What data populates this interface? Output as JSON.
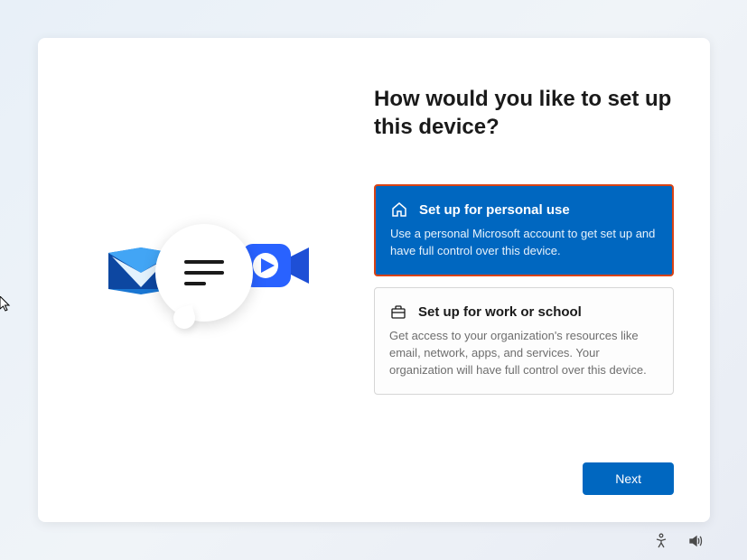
{
  "title": "How would you like to set up this device?",
  "options": [
    {
      "title": "Set up for personal use",
      "description": "Use a personal Microsoft account to get set up and have full control over this device.",
      "selected": true
    },
    {
      "title": "Set up for work or school",
      "description": "Get access to your organization's resources like email, network, apps, and services. Your organization will have full control over this device.",
      "selected": false
    }
  ],
  "next_button": "Next"
}
